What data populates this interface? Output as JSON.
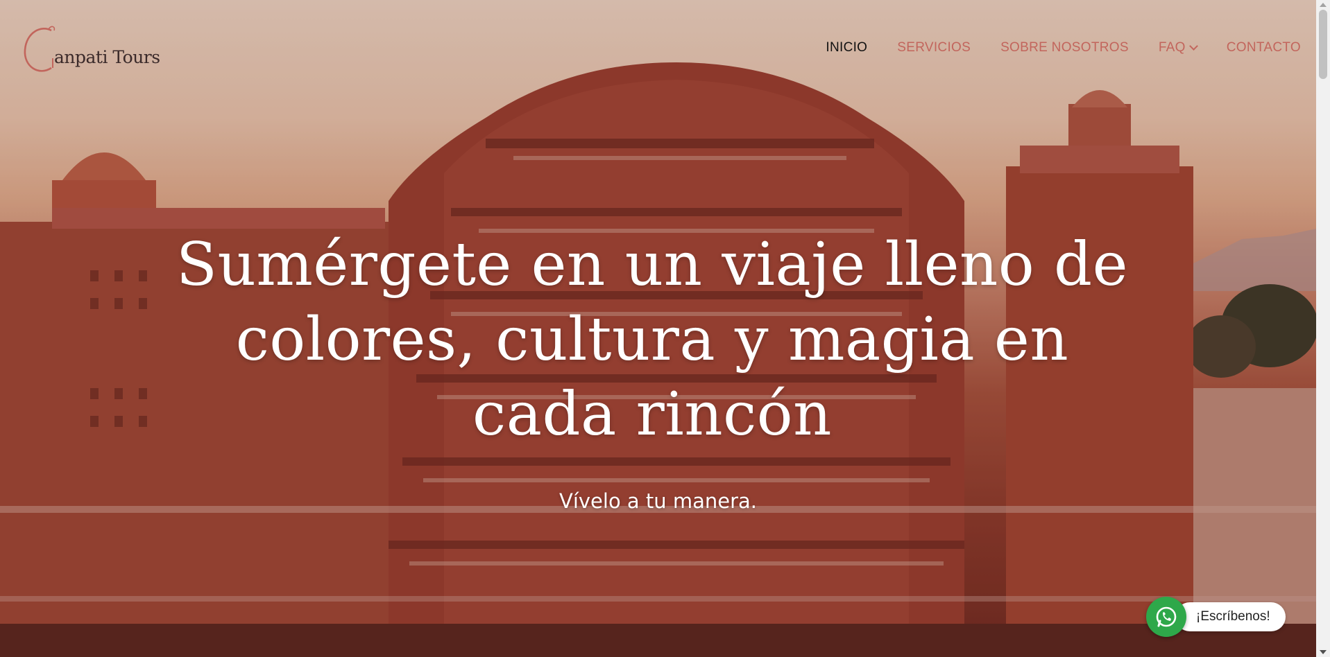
{
  "brand": {
    "logo_initial": "G",
    "logo_text": "anpati Tours"
  },
  "nav": {
    "items": [
      {
        "label": "INICIO",
        "active": true
      },
      {
        "label": "SERVICIOS",
        "active": false
      },
      {
        "label": "SOBRE NOSOTROS",
        "active": false
      },
      {
        "label": "FAQ",
        "active": false,
        "has_dropdown": true
      },
      {
        "label": "CONTACTO",
        "active": false
      }
    ]
  },
  "hero": {
    "headline_lines": [
      "Sumérgete en un viaje lleno de",
      "colores, cultura y magia en",
      "cada rincón"
    ],
    "subheadline": "Vívelo a tu manera.",
    "background": "hawa-mahal-palace-photo"
  },
  "whatsapp": {
    "label": "¡Escríbenos!",
    "icon": "whatsapp-icon",
    "color": "#2ea84a"
  },
  "colors": {
    "nav_accent": "#c2655c",
    "nav_active": "#111111",
    "logo": "#c2655c"
  }
}
